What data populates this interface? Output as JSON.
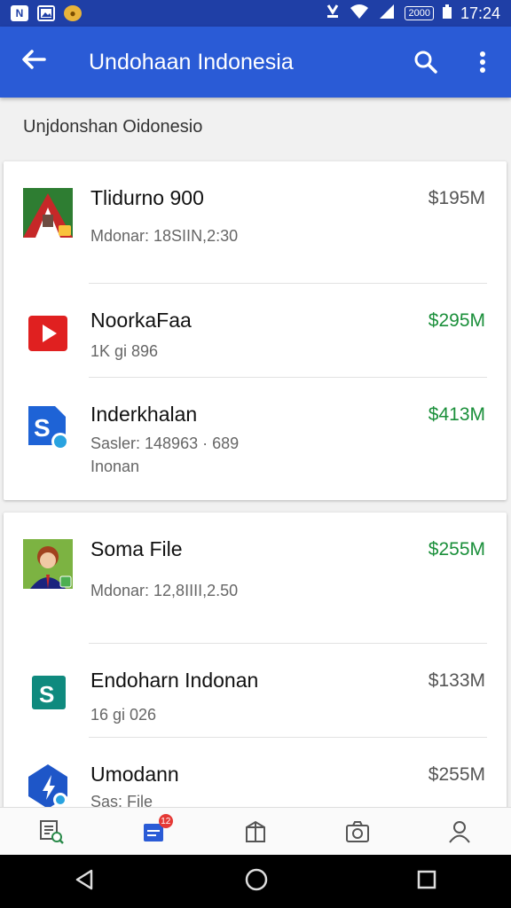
{
  "status_bar": {
    "left_icons": [
      "N",
      "image-icon",
      "coin-icon"
    ],
    "battery_label": "2000",
    "time": "17:24"
  },
  "app_bar": {
    "title": "Undohaan Indonesia",
    "color": "#2a5bd6"
  },
  "section_title": "Unjdonshan Oidonesio",
  "cards": [
    {
      "items": [
        {
          "name": "Tlidurno 900",
          "sub": [
            "Mdonar: 18SIIN,2:30"
          ],
          "price": "$195M",
          "price_color": "gray",
          "icon": "game-icon"
        },
        {
          "name": "NoorkaFaa",
          "sub": [
            "1K gi 896"
          ],
          "price": "$295M",
          "price_color": "green",
          "icon": "play-icon"
        },
        {
          "name": "Inderkhalan",
          "sub": [
            "Sasler: 148963 · 689",
            "Inonan"
          ],
          "price": "$413M",
          "price_color": "green",
          "icon": "file-s-icon"
        }
      ]
    },
    {
      "items": [
        {
          "name": "Soma File",
          "sub": [
            "Mdonar: 12,8IIII,2.50"
          ],
          "price": "$255M",
          "price_color": "green",
          "icon": "profile-photo-icon"
        },
        {
          "name": "Endoharn Indonan",
          "sub": [
            "16 gi 026"
          ],
          "price": "$133M",
          "price_color": "gray",
          "icon": "s-app-icon"
        },
        {
          "name": "Umodann",
          "sub": [
            "Sas: File"
          ],
          "price": "$255M",
          "price_color": "gray",
          "icon": "shield-app-icon"
        }
      ]
    }
  ],
  "bottom_nav": {
    "items": [
      "list-search-icon",
      "inbox-icon",
      "store-icon",
      "camera-icon",
      "person-icon"
    ],
    "badge": "12"
  },
  "system_nav": [
    "back-icon",
    "home-icon",
    "recents-icon"
  ]
}
